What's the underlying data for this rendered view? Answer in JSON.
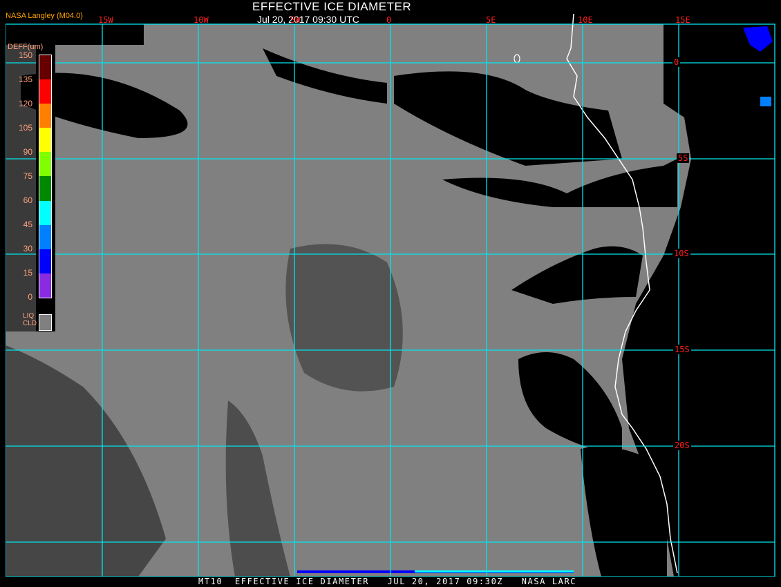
{
  "header": {
    "title": "EFFECTIVE ICE DIAMETER",
    "subtitle": "Jul 20, 2017 09:30 UTC",
    "credit": "NASA Langley (M04.0)"
  },
  "map": {
    "longitude_labels": [
      "15W",
      "10W",
      "5W",
      "0",
      "5E",
      "10E",
      "15E"
    ],
    "latitude_labels": [
      "0",
      "5S",
      "10S",
      "15S",
      "20S"
    ],
    "colors": {
      "grid": "#00e5ee",
      "liquid_cloud": "#808080",
      "clear": "#000000",
      "coastline": "#ffffff",
      "label": "#ff2020"
    }
  },
  "legend": {
    "title": "DEFF(um)",
    "ticks": [
      "150",
      "135",
      "120",
      "105",
      "90",
      "75",
      "60",
      "45",
      "30",
      "15",
      "0"
    ],
    "color_bins": [
      "#660000",
      "#ff0000",
      "#ff8000",
      "#ffff00",
      "#80ff00",
      "#008800",
      "#00ffff",
      "#0080ff",
      "#0000ff",
      "#8a2be2"
    ],
    "liquid_cloud_label_1": "LIQ",
    "liquid_cloud_label_2": "CLD",
    "liquid_cloud_color": "#808080"
  },
  "footer": {
    "text": "MT10  EFFECTIVE ICE DIAMETER   JUL 20, 2017 09:30Z   NASA LARC"
  }
}
